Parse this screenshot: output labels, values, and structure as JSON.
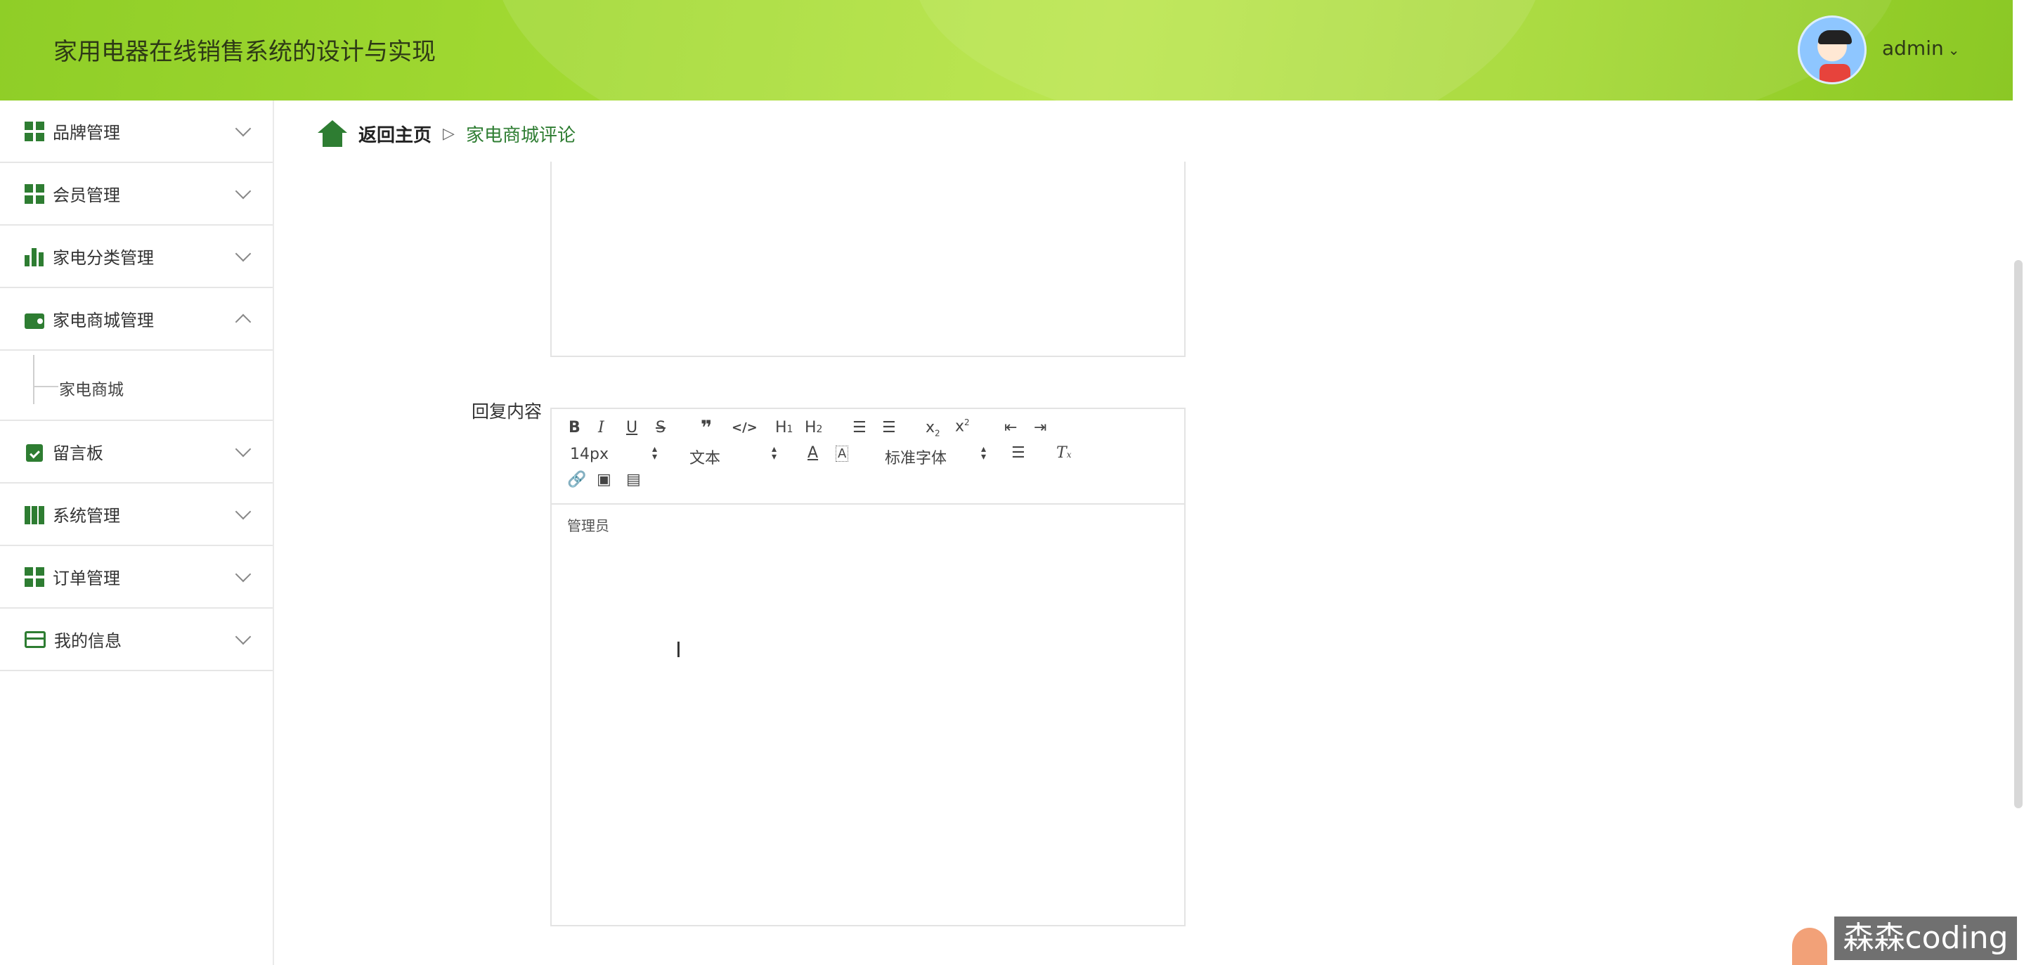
{
  "app": {
    "title": "家用电器在线销售系统的设计与实现",
    "user": "admin",
    "accent_color": "#2e7d32",
    "header_color": "#a6dc35"
  },
  "sidebar": {
    "items": [
      {
        "label": "品牌管理",
        "icon": "grid-icon",
        "expanded": false
      },
      {
        "label": "会员管理",
        "icon": "grid-icon",
        "expanded": false
      },
      {
        "label": "家电分类管理",
        "icon": "bar-chart-icon",
        "expanded": false
      },
      {
        "label": "家电商城管理",
        "icon": "wallet-icon",
        "expanded": true,
        "children": [
          "家电商城"
        ]
      },
      {
        "label": "留言板",
        "icon": "clipboard-check-icon",
        "expanded": false
      },
      {
        "label": "系统管理",
        "icon": "books-icon",
        "expanded": false
      },
      {
        "label": "订单管理",
        "icon": "grid-icon",
        "expanded": false
      },
      {
        "label": "我的信息",
        "icon": "card-icon",
        "expanded": false
      }
    ]
  },
  "breadcrumb": {
    "home": "返回主页",
    "separator": "▷",
    "current": "家电商城评论"
  },
  "form": {
    "reply_label": "回复内容",
    "editor": {
      "font_size": "14px",
      "block_type": "文本",
      "font_family": "标准字体",
      "content": "管理员"
    }
  },
  "watermark": "森森coding"
}
